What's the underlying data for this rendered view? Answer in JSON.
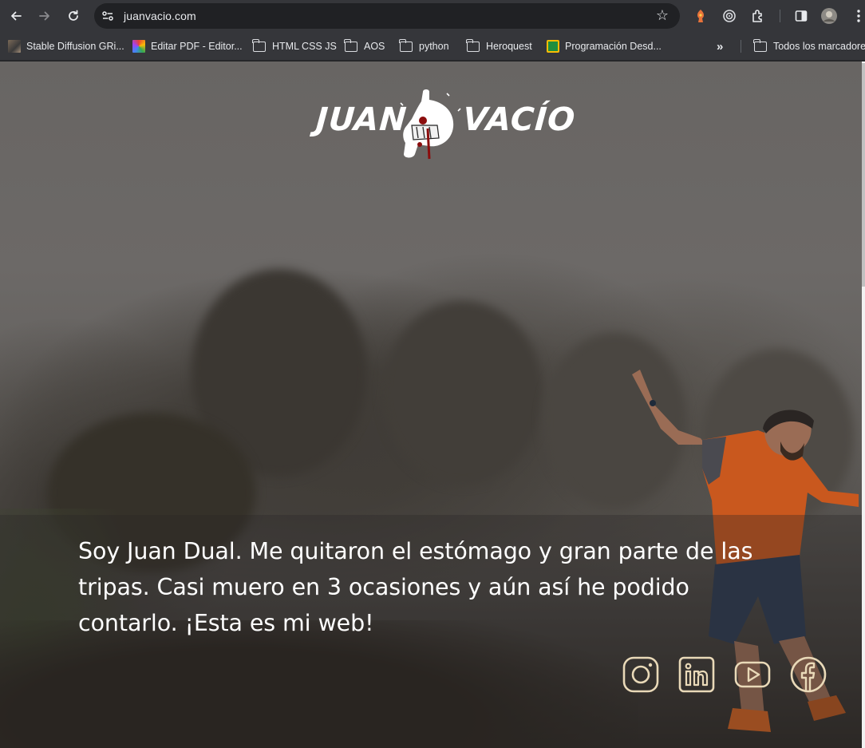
{
  "browser": {
    "url": "juanvacio.com",
    "icons": [
      "back-arrow-icon",
      "forward-arrow-icon",
      "reload-icon",
      "site-info-icon",
      "bookmark-star-icon",
      "extension-icon",
      "target-icon",
      "puzzle-icon",
      "side-panel-icon",
      "profile-avatar",
      "kebab-menu-icon"
    ]
  },
  "bookmarks": {
    "items": [
      {
        "label": "Stable Diffusion GRi...",
        "icon": "image-favicon"
      },
      {
        "label": "Editar PDF - Editor...",
        "icon": "colorful-favicon"
      },
      {
        "label": "HTML CSS JS",
        "icon": "folder-icon"
      },
      {
        "label": "AOS",
        "icon": "folder-icon"
      },
      {
        "label": "python",
        "icon": "folder-icon"
      },
      {
        "label": "Heroquest",
        "icon": "folder-icon"
      },
      {
        "label": "Programación Desd...",
        "icon": "classroom-favicon"
      }
    ],
    "overflow": "»",
    "all_bookmarks": "Todos los marcadores"
  },
  "hero": {
    "logo_left": "JUAN",
    "logo_right": "VACÍO",
    "intro_line1": "Soy Juan Dual. Me quitaron el estómago y gran parte de las",
    "intro_line2": "tripas. Casi muero en 3 ocasiones y aún así he podido",
    "intro_line3": "contarlo. ¡Esta es mi web!",
    "social": [
      "instagram-icon",
      "linkedin-icon",
      "youtube-icon",
      "facebook-icon"
    ],
    "social_color": "#e9d9b8"
  }
}
